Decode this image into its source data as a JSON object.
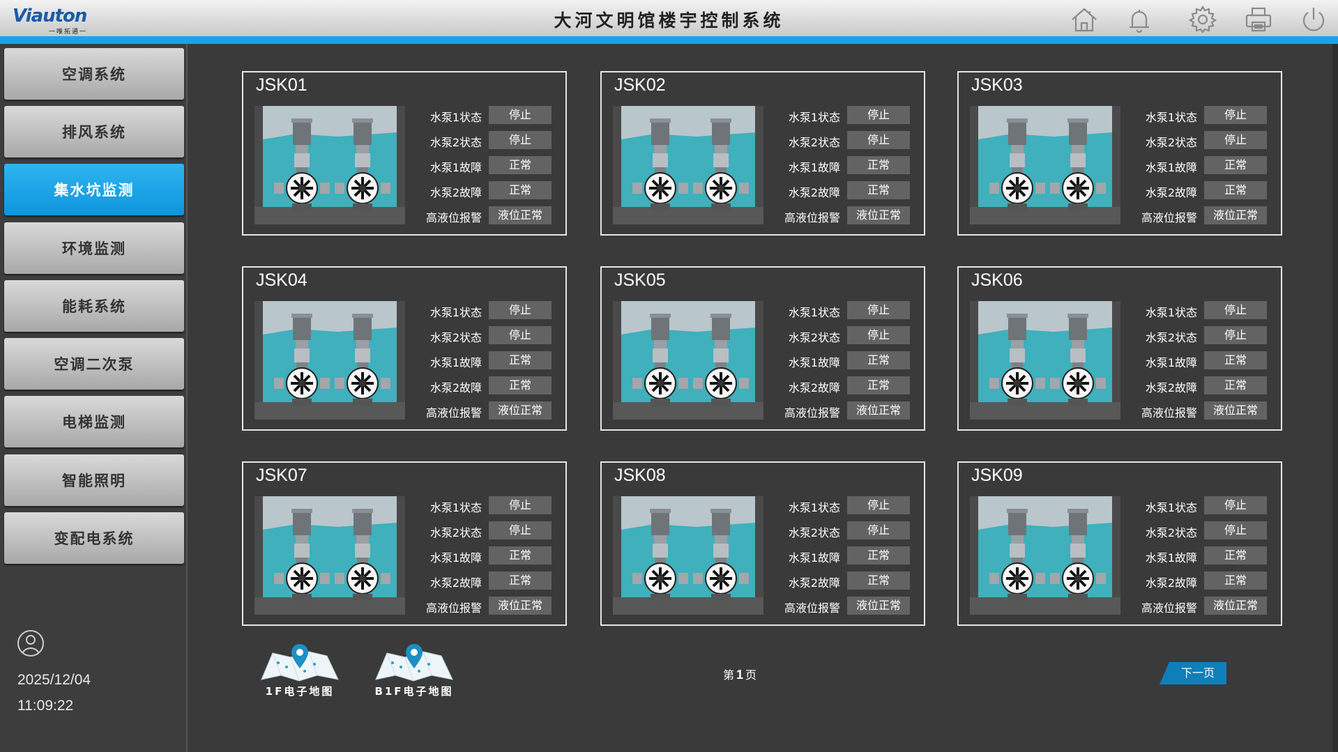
{
  "header": {
    "logo_text": "Viauton",
    "logo_subtitle": "一唯拓通一",
    "title": "大河文明馆楼宇控制系统",
    "icons": [
      "home-icon",
      "bell-icon",
      "gear-icon",
      "printer-icon",
      "power-icon"
    ]
  },
  "sidebar": {
    "items": [
      {
        "label": "空调系统",
        "active": false
      },
      {
        "label": "排风系统",
        "active": false
      },
      {
        "label": "集水坑监测",
        "active": true
      },
      {
        "label": "环境监测",
        "active": false
      },
      {
        "label": "能耗系统",
        "active": false
      },
      {
        "label": "空调二次泵",
        "active": false
      },
      {
        "label": "电梯监测",
        "active": false
      },
      {
        "label": "智能照明",
        "active": false
      },
      {
        "label": "变配电系统",
        "active": false
      }
    ],
    "date": "2025/12/04",
    "time": "11:09:22"
  },
  "cards": [
    {
      "name": "JSK01",
      "rows": [
        {
          "label": "水泵1状态",
          "value": "停止"
        },
        {
          "label": "水泵2状态",
          "value": "停止"
        },
        {
          "label": "水泵1故障",
          "value": "正常"
        },
        {
          "label": "水泵2故障",
          "value": "正常"
        },
        {
          "label": "高液位报警",
          "value": "液位正常"
        }
      ]
    },
    {
      "name": "JSK02",
      "rows": [
        {
          "label": "水泵1状态",
          "value": "停止"
        },
        {
          "label": "水泵2状态",
          "value": "停止"
        },
        {
          "label": "水泵1故障",
          "value": "正常"
        },
        {
          "label": "水泵2故障",
          "value": "正常"
        },
        {
          "label": "高液位报警",
          "value": "液位正常"
        }
      ]
    },
    {
      "name": "JSK03",
      "rows": [
        {
          "label": "水泵1状态",
          "value": "停止"
        },
        {
          "label": "水泵2状态",
          "value": "停止"
        },
        {
          "label": "水泵1故障",
          "value": "正常"
        },
        {
          "label": "水泵2故障",
          "value": "正常"
        },
        {
          "label": "高液位报警",
          "value": "液位正常"
        }
      ]
    },
    {
      "name": "JSK04",
      "rows": [
        {
          "label": "水泵1状态",
          "value": "停止"
        },
        {
          "label": "水泵2状态",
          "value": "停止"
        },
        {
          "label": "水泵1故障",
          "value": "正常"
        },
        {
          "label": "水泵2故障",
          "value": "正常"
        },
        {
          "label": "高液位报警",
          "value": "液位正常"
        }
      ]
    },
    {
      "name": "JSK05",
      "rows": [
        {
          "label": "水泵1状态",
          "value": "停止"
        },
        {
          "label": "水泵2状态",
          "value": "停止"
        },
        {
          "label": "水泵1故障",
          "value": "正常"
        },
        {
          "label": "水泵2故障",
          "value": "正常"
        },
        {
          "label": "高液位报警",
          "value": "液位正常"
        }
      ]
    },
    {
      "name": "JSK06",
      "rows": [
        {
          "label": "水泵1状态",
          "value": "停止"
        },
        {
          "label": "水泵2状态",
          "value": "停止"
        },
        {
          "label": "水泵1故障",
          "value": "正常"
        },
        {
          "label": "水泵2故障",
          "value": "正常"
        },
        {
          "label": "高液位报警",
          "value": "液位正常"
        }
      ]
    },
    {
      "name": "JSK07",
      "rows": [
        {
          "label": "水泵1状态",
          "value": "停止"
        },
        {
          "label": "水泵2状态",
          "value": "停止"
        },
        {
          "label": "水泵1故障",
          "value": "正常"
        },
        {
          "label": "水泵2故障",
          "value": "正常"
        },
        {
          "label": "高液位报警",
          "value": "液位正常"
        }
      ]
    },
    {
      "name": "JSK08",
      "rows": [
        {
          "label": "水泵1状态",
          "value": "停止"
        },
        {
          "label": "水泵2状态",
          "value": "停止"
        },
        {
          "label": "水泵1故障",
          "value": "正常"
        },
        {
          "label": "水泵2故障",
          "value": "正常"
        },
        {
          "label": "高液位报警",
          "value": "液位正常"
        }
      ]
    },
    {
      "name": "JSK09",
      "rows": [
        {
          "label": "水泵1状态",
          "value": "停止"
        },
        {
          "label": "水泵2状态",
          "value": "停止"
        },
        {
          "label": "水泵1故障",
          "value": "正常"
        },
        {
          "label": "水泵2故障",
          "value": "正常"
        },
        {
          "label": "高液位报警",
          "value": "液位正常"
        }
      ]
    }
  ],
  "maps": [
    {
      "label": "1F电子地图",
      "icon": "map-pin-icon"
    },
    {
      "label": "B1F电子地图",
      "icon": "map-pin-icon"
    }
  ],
  "pagination": {
    "prefix": "第",
    "current": "1",
    "suffix": "页",
    "next_label": "下一页"
  },
  "colors": {
    "accent": "#1aa3e8",
    "active_nav": "#1a9fe3",
    "next_button": "#0e7fb9",
    "water": "#3fb0bc"
  }
}
